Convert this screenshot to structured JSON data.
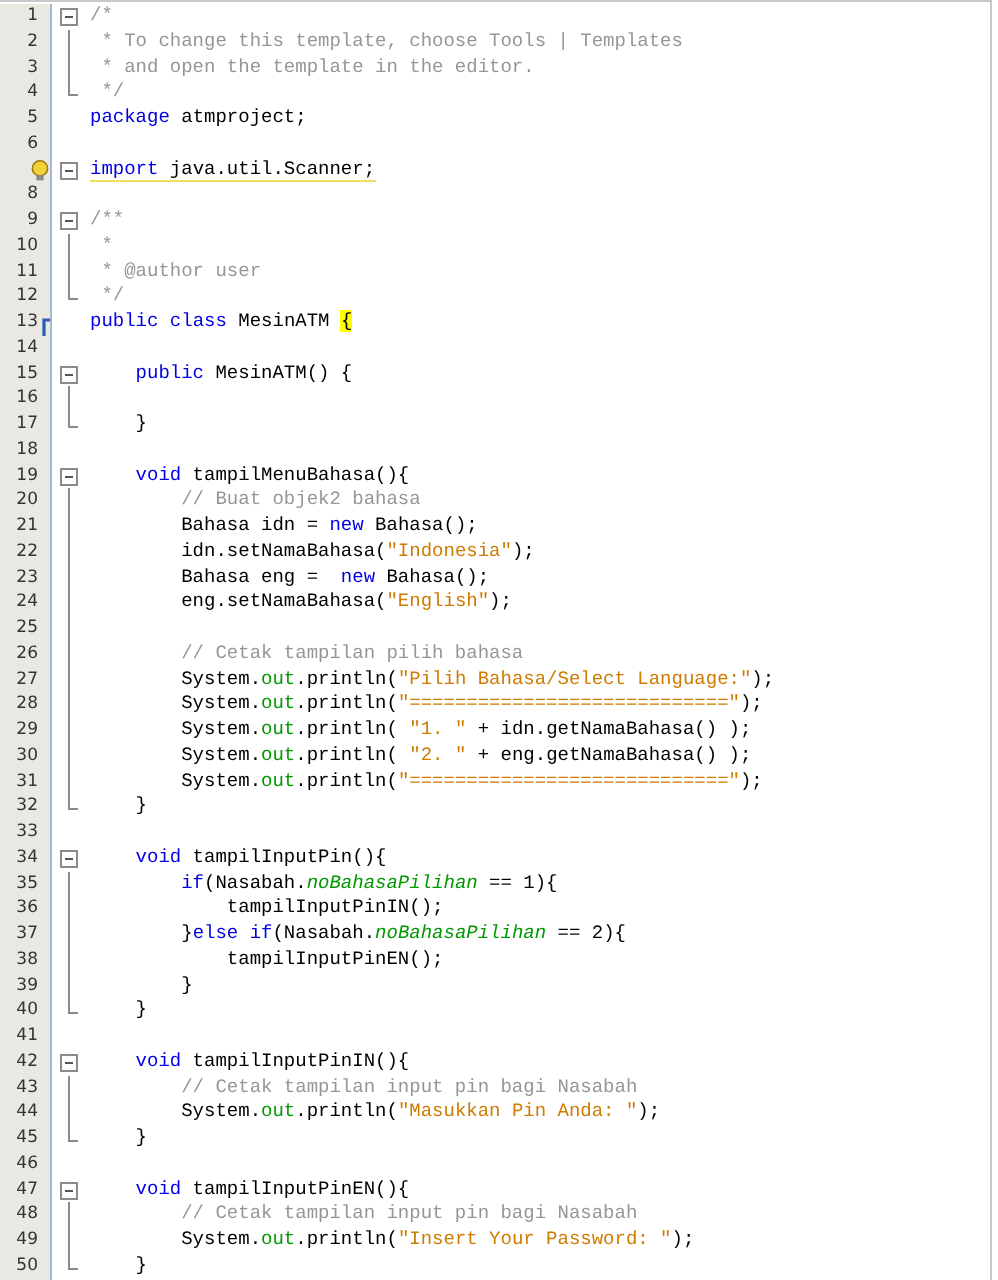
{
  "editor": {
    "lines": [
      {
        "n": "1",
        "fold": {
          "kind": "open"
        },
        "segments": [
          {
            "kind": "com",
            "text": "/*"
          }
        ]
      },
      {
        "n": "2",
        "fold": {
          "kind": "bar"
        },
        "segments": [
          {
            "kind": "com",
            "text": " * To change this template, choose Tools | Templates"
          }
        ]
      },
      {
        "n": "3",
        "fold": {
          "kind": "bar"
        },
        "segments": [
          {
            "kind": "com",
            "text": " * and open the template in the editor."
          }
        ]
      },
      {
        "n": "4",
        "fold": {
          "kind": "end"
        },
        "segments": [
          {
            "kind": "com",
            "text": " */"
          }
        ]
      },
      {
        "n": "5",
        "segments": [
          {
            "kind": "kw",
            "text": "package"
          },
          {
            "kind": "plain",
            "text": " atmproject;"
          }
        ]
      },
      {
        "n": "6"
      },
      {
        "hint": true,
        "fold": {
          "kind": "open"
        },
        "warning": true,
        "segments": [
          {
            "kind": "kw",
            "text": "import"
          },
          {
            "kind": "plain",
            "text": " java.util.Scanner;"
          }
        ]
      },
      {
        "n": "8"
      },
      {
        "n": "9",
        "fold": {
          "kind": "open"
        },
        "segments": [
          {
            "kind": "com",
            "text": "/**"
          }
        ]
      },
      {
        "n": "10",
        "fold": {
          "kind": "bar"
        },
        "segments": [
          {
            "kind": "com",
            "text": " *"
          }
        ]
      },
      {
        "n": "11",
        "fold": {
          "kind": "bar"
        },
        "segments": [
          {
            "kind": "com",
            "text": " * @author user"
          }
        ]
      },
      {
        "n": "12",
        "fold": {
          "kind": "end"
        },
        "segments": [
          {
            "kind": "com",
            "text": " */"
          }
        ]
      },
      {
        "n": "13",
        "marker": true,
        "segments": [
          {
            "kind": "kw",
            "text": "public"
          },
          {
            "kind": "kw",
            "text": " class"
          },
          {
            "kind": "plain",
            "text": " MesinATM "
          },
          {
            "kind": "match",
            "text": "{"
          }
        ]
      },
      {
        "n": "14"
      },
      {
        "n": "15",
        "fold": {
          "kind": "open"
        },
        "segments": [
          {
            "kind": "kw",
            "text": "    public"
          },
          {
            "kind": "plain",
            "text": " MesinATM() {"
          }
        ]
      },
      {
        "n": "16",
        "fold": {
          "kind": "bar"
        }
      },
      {
        "n": "17",
        "fold": {
          "kind": "end"
        },
        "segments": [
          {
            "kind": "plain",
            "text": "    }"
          }
        ]
      },
      {
        "n": "18"
      },
      {
        "n": "19",
        "fold": {
          "kind": "open"
        },
        "segments": [
          {
            "kind": "kw",
            "text": "    void"
          },
          {
            "kind": "plain",
            "text": " tampilMenuBahasa(){"
          }
        ]
      },
      {
        "n": "20",
        "fold": {
          "kind": "bar"
        },
        "segments": [
          {
            "kind": "com",
            "text": "        // Buat objek2 bahasa"
          }
        ]
      },
      {
        "n": "21",
        "fold": {
          "kind": "bar"
        },
        "segments": [
          {
            "kind": "plain",
            "text": "        Bahasa idn = "
          },
          {
            "kind": "kw",
            "text": "new"
          },
          {
            "kind": "plain",
            "text": " Bahasa();"
          }
        ]
      },
      {
        "n": "22",
        "fold": {
          "kind": "bar"
        },
        "segments": [
          {
            "kind": "plain",
            "text": "        idn.setNamaBahasa("
          },
          {
            "kind": "str",
            "text": "\"Indonesia\""
          },
          {
            "kind": "plain",
            "text": ");"
          }
        ]
      },
      {
        "n": "23",
        "fold": {
          "kind": "bar"
        },
        "segments": [
          {
            "kind": "plain",
            "text": "        Bahasa eng =  "
          },
          {
            "kind": "kw",
            "text": "new"
          },
          {
            "kind": "plain",
            "text": " Bahasa();"
          }
        ]
      },
      {
        "n": "24",
        "fold": {
          "kind": "bar"
        },
        "segments": [
          {
            "kind": "plain",
            "text": "        eng.setNamaBahasa("
          },
          {
            "kind": "str",
            "text": "\"English\""
          },
          {
            "kind": "plain",
            "text": ");"
          }
        ]
      },
      {
        "n": "25",
        "fold": {
          "kind": "bar"
        }
      },
      {
        "n": "26",
        "fold": {
          "kind": "bar"
        },
        "segments": [
          {
            "kind": "com",
            "text": "        // Cetak tampilan pilih bahasa"
          }
        ]
      },
      {
        "n": "27",
        "fold": {
          "kind": "bar"
        },
        "segments": [
          {
            "kind": "plain",
            "text": "        System."
          },
          {
            "kind": "field",
            "text": "out"
          },
          {
            "kind": "plain",
            "text": ".println("
          },
          {
            "kind": "str",
            "text": "\"Pilih Bahasa/Select Language:\""
          },
          {
            "kind": "plain",
            "text": ");"
          }
        ]
      },
      {
        "n": "28",
        "fold": {
          "kind": "bar"
        },
        "segments": [
          {
            "kind": "plain",
            "text": "        System."
          },
          {
            "kind": "field",
            "text": "out"
          },
          {
            "kind": "plain",
            "text": ".println("
          },
          {
            "kind": "str",
            "text": "\"============================\""
          },
          {
            "kind": "plain",
            "text": ");"
          }
        ]
      },
      {
        "n": "29",
        "fold": {
          "kind": "bar"
        },
        "segments": [
          {
            "kind": "plain",
            "text": "        System."
          },
          {
            "kind": "field",
            "text": "out"
          },
          {
            "kind": "plain",
            "text": ".println("
          },
          {
            "kind": "str",
            "text": " \"1. \""
          },
          {
            "kind": "plain",
            "text": " + idn.getNamaBahasa() );"
          }
        ]
      },
      {
        "n": "30",
        "fold": {
          "kind": "bar"
        },
        "segments": [
          {
            "kind": "plain",
            "text": "        System."
          },
          {
            "kind": "field",
            "text": "out"
          },
          {
            "kind": "plain",
            "text": ".println("
          },
          {
            "kind": "str",
            "text": " \"2. \""
          },
          {
            "kind": "plain",
            "text": " + eng.getNamaBahasa() );"
          }
        ]
      },
      {
        "n": "31",
        "fold": {
          "kind": "bar"
        },
        "segments": [
          {
            "kind": "plain",
            "text": "        System."
          },
          {
            "kind": "field",
            "text": "out"
          },
          {
            "kind": "plain",
            "text": ".println("
          },
          {
            "kind": "str",
            "text": "\"============================\""
          },
          {
            "kind": "plain",
            "text": ");"
          }
        ]
      },
      {
        "n": "32",
        "fold": {
          "kind": "end"
        },
        "segments": [
          {
            "kind": "plain",
            "text": "    }"
          }
        ]
      },
      {
        "n": "33"
      },
      {
        "n": "34",
        "fold": {
          "kind": "open"
        },
        "segments": [
          {
            "kind": "kw",
            "text": "    void"
          },
          {
            "kind": "plain",
            "text": " tampilInputPin(){"
          }
        ]
      },
      {
        "n": "35",
        "fold": {
          "kind": "bar"
        },
        "segments": [
          {
            "kind": "kw",
            "text": "        if"
          },
          {
            "kind": "plain",
            "text": "(Nasabah."
          },
          {
            "kind": "sfield",
            "text": "noBahasaPilihan"
          },
          {
            "kind": "plain",
            "text": " == 1){"
          }
        ]
      },
      {
        "n": "36",
        "fold": {
          "kind": "bar"
        },
        "segments": [
          {
            "kind": "plain",
            "text": "            tampilInputPinIN();"
          }
        ]
      },
      {
        "n": "37",
        "fold": {
          "kind": "bar"
        },
        "segments": [
          {
            "kind": "plain",
            "text": "        }"
          },
          {
            "kind": "kw",
            "text": "else"
          },
          {
            "kind": "kw",
            "text": " if"
          },
          {
            "kind": "plain",
            "text": "(Nasabah."
          },
          {
            "kind": "sfield",
            "text": "noBahasaPilihan"
          },
          {
            "kind": "plain",
            "text": " == 2){"
          }
        ]
      },
      {
        "n": "38",
        "fold": {
          "kind": "bar"
        },
        "segments": [
          {
            "kind": "plain",
            "text": "            tampilInputPinEN();"
          }
        ]
      },
      {
        "n": "39",
        "fold": {
          "kind": "bar"
        },
        "segments": [
          {
            "kind": "plain",
            "text": "        }"
          }
        ]
      },
      {
        "n": "40",
        "fold": {
          "kind": "end"
        },
        "segments": [
          {
            "kind": "plain",
            "text": "    }"
          }
        ]
      },
      {
        "n": "41"
      },
      {
        "n": "42",
        "fold": {
          "kind": "open"
        },
        "segments": [
          {
            "kind": "kw",
            "text": "    void"
          },
          {
            "kind": "plain",
            "text": " tampilInputPinIN(){"
          }
        ]
      },
      {
        "n": "43",
        "fold": {
          "kind": "bar"
        },
        "segments": [
          {
            "kind": "com",
            "text": "        // Cetak tampilan input pin bagi Nasabah"
          }
        ]
      },
      {
        "n": "44",
        "fold": {
          "kind": "bar"
        },
        "segments": [
          {
            "kind": "plain",
            "text": "        System."
          },
          {
            "kind": "field",
            "text": "out"
          },
          {
            "kind": "plain",
            "text": ".println("
          },
          {
            "kind": "str",
            "text": "\"Masukkan Pin Anda: \""
          },
          {
            "kind": "plain",
            "text": ");"
          }
        ]
      },
      {
        "n": "45",
        "fold": {
          "kind": "end"
        },
        "segments": [
          {
            "kind": "plain",
            "text": "    }"
          }
        ]
      },
      {
        "n": "46"
      },
      {
        "n": "47",
        "fold": {
          "kind": "open"
        },
        "segments": [
          {
            "kind": "kw",
            "text": "    void"
          },
          {
            "kind": "plain",
            "text": " tampilInputPinEN(){"
          }
        ]
      },
      {
        "n": "48",
        "fold": {
          "kind": "bar"
        },
        "segments": [
          {
            "kind": "com",
            "text": "        // Cetak tampilan input pin bagi Nasabah"
          }
        ]
      },
      {
        "n": "49",
        "fold": {
          "kind": "bar"
        },
        "segments": [
          {
            "kind": "plain",
            "text": "        System."
          },
          {
            "kind": "field",
            "text": "out"
          },
          {
            "kind": "plain",
            "text": ".println("
          },
          {
            "kind": "str",
            "text": "\"Insert Your Password: \""
          },
          {
            "kind": "plain",
            "text": ");"
          }
        ]
      },
      {
        "n": "50",
        "fold": {
          "kind": "end"
        },
        "segments": [
          {
            "kind": "plain",
            "text": "    }"
          }
        ]
      }
    ]
  }
}
